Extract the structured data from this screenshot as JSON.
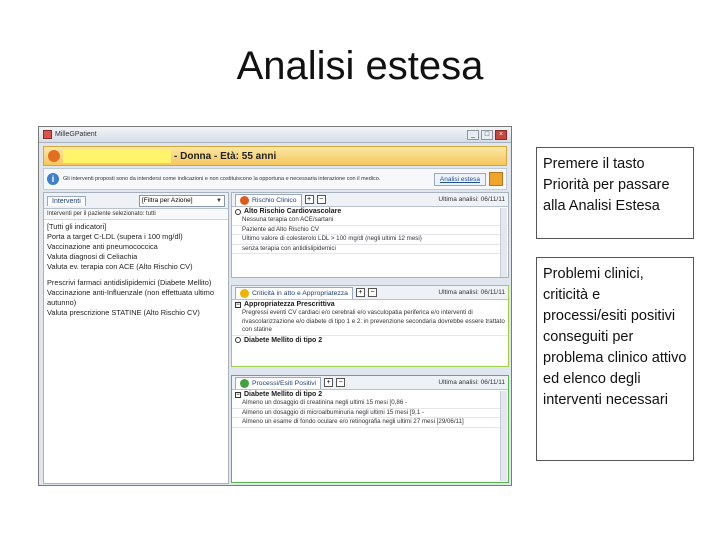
{
  "slide": {
    "title": "Analisi estesa"
  },
  "window": {
    "title": "MilleGPatient",
    "controls": {
      "minimize": "_",
      "maximize": "□",
      "close": "×"
    }
  },
  "patient": {
    "text": "- Donna - Età: 55 anni"
  },
  "info": {
    "text": "Gli interventi proposti sono da intendersi come indicazioni e non costituiscono la opportuna e necessaria interazione con il medico.",
    "button": "Analisi estesa"
  },
  "interventi": {
    "tab": "Interventi",
    "filter": "[Filtra per Azione]",
    "subheader": "Interventi per il paziente selezionato: tutti",
    "items": [
      "[Tutti gli indicatori]",
      "Porta a target C-LDL (supera i 100 mg/dl)",
      "Vaccinazione anti pneumococcica",
      "Valuta diagnosi di Celiachia",
      "Valuta ev. terapia con ACE (Alto Rischio CV)"
    ],
    "items2": [
      "Prescrivi farmaci antidislipidemici (Diabete Mellito)",
      "Vaccinazione anti-Influenzale (non effettuata ultimo autunno)",
      "Valuta prescrizione STATINE (Alto Rischio CV)"
    ]
  },
  "rischio": {
    "tab": "Rischio Clinico",
    "date": "Ultima analisi: 06/11/11",
    "header": "Alto Rischio Cardiovascolare",
    "rows": [
      "Nessuna terapia con ACE/sartani",
      "Paziente ad Alto Rischio CV",
      "Ultimo valore di colesterolo LDL > 100 mg/dl (negli ultimi 12 mesi)",
      "senza terapia con antidislipidemici"
    ]
  },
  "criticita": {
    "tab": "Criticità in atto e Appropriatezza",
    "date": "Ultima analisi: 06/11/11",
    "header": "Appropriatezza Prescrittiva",
    "text": "Pregressi eventi CV cardiaci e/o cerebrali e/o vasculopatia periferica e/o interventi di rivascolarizzazione e/o diabete di tipo 1 e 2: in prevenzione secondaria dovrebbe essere trattato con statine",
    "footer": "Diabete Mellito di tipo 2"
  },
  "processi": {
    "tab": "Processi/Esiti Positivi",
    "date": "Ultima analisi: 06/11/11",
    "header": "Diabete Mellito di tipo 2",
    "rows": [
      "Almeno un dosaggio di creatinina negli ultimi 15 mesi [0,86 -",
      "Almeno un dosaggio di microalbuminuria negli ultimi 15 mesi [9,1 -",
      "Almeno un esame di fondo oculare e/o retinografia negli ultimi 27 mesi [29/06/11]"
    ]
  },
  "callouts": {
    "first": "Premere il tasto Priorità per passare alla Analisi Estesa",
    "second": "Problemi clinici, criticità e processi/esiti positivi conseguiti per problema clinico attivo ed elenco degli interventi necessari"
  },
  "colors": {
    "rischio_dot": "#e05a1c",
    "criticita_dot": "#f0b400",
    "processi_dot": "#3fa43a",
    "criticita_border": "#9fd04a",
    "processi_border": "#55b84a"
  }
}
